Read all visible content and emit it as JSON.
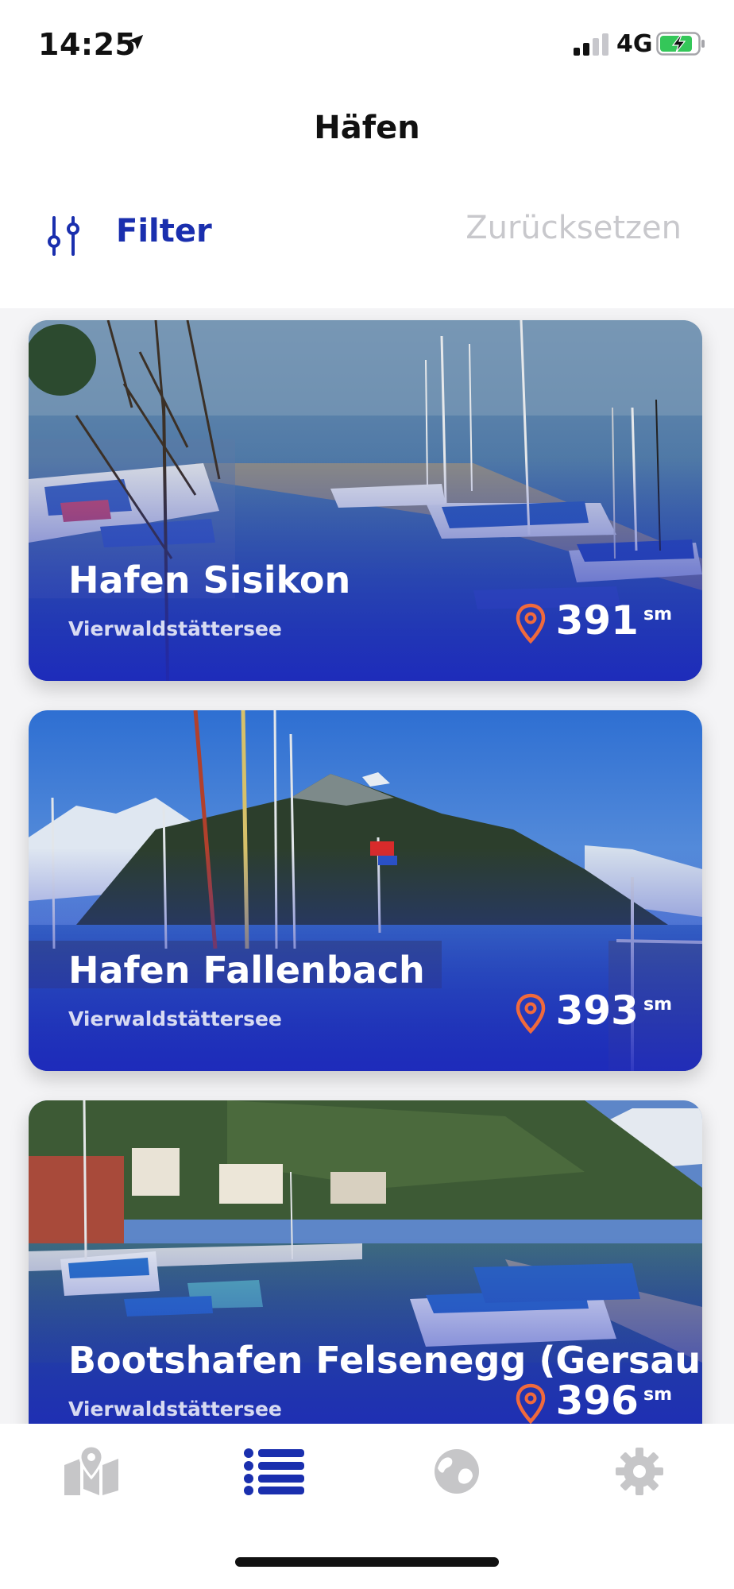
{
  "status_bar": {
    "time": "14:25",
    "network": "4G",
    "battery_color": "#34c759"
  },
  "header": {
    "title": "Häfen"
  },
  "filter_bar": {
    "filter_label": "Filter",
    "reset_label": "Zurücksetzen",
    "accent_color": "#1a2fae",
    "reset_color": "#c8c8cc"
  },
  "harbors": [
    {
      "name": "Hafen Sisikon",
      "lake": "Vierwaldstättersee",
      "distance": "391",
      "unit": "sm",
      "image": "harbor-sailboats-photo"
    },
    {
      "name": "Hafen Fallenbach",
      "lake": "Vierwaldstättersee",
      "distance": "393",
      "unit": "sm",
      "image": "harbor-mountains-photo"
    },
    {
      "name": "Bootshafen Felsenegg (Gersau)",
      "lake": "Vierwaldstättersee",
      "distance": "396",
      "unit": "sm",
      "image": "harbor-village-photo"
    }
  ],
  "tab_bar": {
    "tabs": [
      {
        "icon": "map-icon",
        "active": false
      },
      {
        "icon": "list-icon",
        "active": true
      },
      {
        "icon": "globe-icon",
        "active": false
      },
      {
        "icon": "gear-icon",
        "active": false
      }
    ],
    "active_color": "#1a2fae",
    "inactive_color": "#c6c6c8"
  },
  "pin_color": "#f06a3c"
}
